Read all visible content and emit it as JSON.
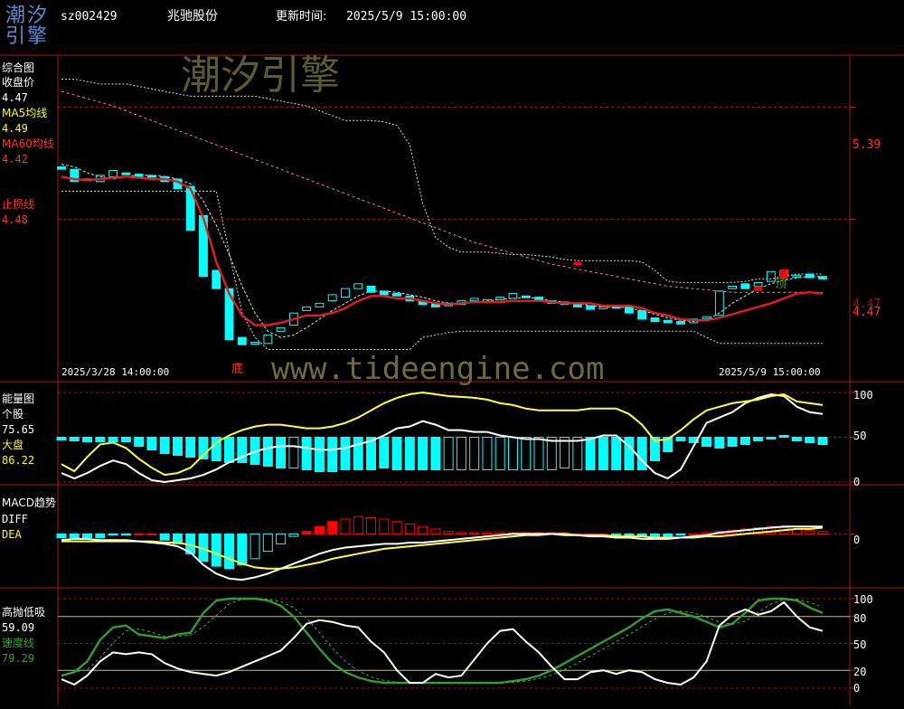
{
  "header": {
    "logo_text": "潮汐引擎",
    "symbol": "sz002429",
    "name": "兆驰股份",
    "update_label": "更新时间:",
    "update_time": "2025/5/9 15:00:00"
  },
  "watermark": {
    "title": "潮汐引擎",
    "url": "www.tideengine.com"
  },
  "colors": {
    "background": "#000000",
    "price_line": "#e61c1c",
    "price_dash": "#ff8080",
    "down_candle": "#00ffff",
    "up_candle": "#ff0000",
    "energy_line_a": "#ffff33",
    "energy_line_b": "#ffffff",
    "high_low_line": "#ffffff",
    "speed_line": "#2e9e2e"
  },
  "panels": {
    "price": {
      "title": "综合图",
      "close_label": "收盘价",
      "close_value": "4.47",
      "ma5_label": "MA5均线",
      "ma5_value": "4.49",
      "ma60_label": "MA60均线",
      "ma60_value": "4.42",
      "stop_label": "止损线",
      "stop_value": "4.48",
      "right_ticks": [
        "5.39",
        "4.47"
      ],
      "current_price": "4.47",
      "top_marker": "顶",
      "bottom_marker": "底",
      "date_start": "2025/3/28 14:00:00",
      "date_end": "2025/5/9 15:00:00"
    },
    "energy": {
      "title": "能量图",
      "stock_label": "个股",
      "stock_value": "75.65",
      "market_label": "大盘",
      "market_value": "86.22",
      "ticks": [
        "100",
        "50",
        "0"
      ]
    },
    "macd": {
      "title": "MACD趋势",
      "diff_label": "DIFF",
      "dea_label": "DEA",
      "tick": "0"
    },
    "highlow": {
      "title": "高抛低吸",
      "value": "59.09",
      "speed_label": "速度线",
      "speed_value": "79.29",
      "ticks": [
        "100",
        "80",
        "50",
        "20",
        "0"
      ]
    }
  },
  "chart_data": [
    {
      "type": "line",
      "title": "综合图",
      "n": 60,
      "ylim": [
        3.3,
        5.75
      ],
      "series": [
        {
          "name": "收盘价",
          "kind": "candles",
          "open": [
            4.9,
            4.88,
            4.8,
            4.78,
            4.82,
            4.85,
            4.84,
            4.83,
            4.82,
            4.8,
            4.74,
            4.5,
            4.05,
            3.9,
            3.5,
            3.45,
            3.45,
            3.55,
            3.6,
            3.72,
            3.75,
            3.8,
            3.83,
            3.9,
            3.92,
            3.88,
            3.86,
            3.84,
            3.8,
            3.78,
            3.76,
            3.77,
            3.8,
            3.79,
            3.81,
            3.82,
            3.84,
            3.83,
            3.8,
            3.79,
            3.78,
            3.76,
            3.74,
            3.76,
            3.75,
            3.72,
            3.66,
            3.64,
            3.63,
            3.62,
            3.66,
            3.68,
            3.9,
            3.94,
            3.92,
            3.96,
            4.05,
            4.0,
            4.02,
            4.0
          ],
          "close": [
            4.88,
            4.78,
            4.79,
            4.83,
            4.87,
            4.84,
            4.82,
            4.82,
            4.78,
            4.72,
            4.38,
            4.0,
            3.9,
            3.48,
            3.44,
            3.46,
            3.52,
            3.58,
            3.7,
            3.75,
            3.78,
            3.85,
            3.9,
            3.94,
            3.87,
            3.85,
            3.84,
            3.8,
            3.77,
            3.75,
            3.78,
            3.8,
            3.82,
            3.81,
            3.83,
            3.86,
            3.83,
            3.8,
            3.78,
            3.77,
            3.75,
            3.73,
            3.75,
            3.74,
            3.7,
            3.65,
            3.63,
            3.62,
            3.61,
            3.65,
            3.67,
            3.88,
            3.92,
            3.9,
            3.95,
            4.04,
            4.0,
            4.01,
            3.99,
            3.98
          ]
        },
        {
          "name": "MA5均线",
          "values": [
            4.92,
            4.9,
            4.85,
            4.82,
            4.8,
            4.82,
            4.83,
            4.83,
            4.82,
            4.8,
            4.76,
            4.62,
            4.42,
            4.18,
            3.92,
            3.7,
            3.55,
            3.5,
            3.52,
            3.58,
            3.65,
            3.72,
            3.78,
            3.84,
            3.88,
            3.88,
            3.87,
            3.85,
            3.83,
            3.8,
            3.78,
            3.78,
            3.79,
            3.8,
            3.81,
            3.82,
            3.83,
            3.82,
            3.8,
            3.79,
            3.78,
            3.76,
            3.75,
            3.75,
            3.74,
            3.72,
            3.69,
            3.66,
            3.64,
            3.63,
            3.64,
            3.7,
            3.78,
            3.84,
            3.9,
            3.94,
            3.97,
            3.99,
            4.0,
            4.0
          ]
        },
        {
          "name": "MA60均线",
          "values": [
            5.52,
            5.49,
            5.46,
            5.43,
            5.4,
            5.36,
            5.32,
            5.28,
            5.24,
            5.2,
            5.16,
            5.12,
            5.08,
            5.04,
            5.0,
            4.96,
            4.92,
            4.88,
            4.84,
            4.8,
            4.76,
            4.72,
            4.68,
            4.64,
            4.6,
            4.56,
            4.52,
            4.48,
            4.44,
            4.4,
            4.36,
            4.32,
            4.28,
            4.25,
            4.22,
            4.19,
            4.16,
            4.13,
            4.1,
            4.08,
            4.06,
            4.04,
            4.02,
            4.0,
            3.98,
            3.96,
            3.94,
            3.92,
            3.91,
            3.9,
            3.89,
            3.88,
            3.87,
            3.87,
            3.87,
            3.87,
            3.87,
            3.87,
            3.87,
            3.87
          ]
        },
        {
          "name": "止损线",
          "values": [
            4.82,
            4.8,
            4.79,
            4.8,
            4.81,
            4.82,
            4.81,
            4.8,
            4.8,
            4.78,
            4.72,
            4.48,
            4.12,
            3.86,
            3.68,
            3.6,
            3.6,
            3.62,
            3.65,
            3.68,
            3.68,
            3.7,
            3.74,
            3.8,
            3.84,
            3.84,
            3.82,
            3.82,
            3.8,
            3.78,
            3.77,
            3.78,
            3.79,
            3.79,
            3.79,
            3.8,
            3.8,
            3.8,
            3.79,
            3.78,
            3.78,
            3.78,
            3.76,
            3.76,
            3.76,
            3.74,
            3.7,
            3.68,
            3.65,
            3.64,
            3.64,
            3.66,
            3.69,
            3.72,
            3.75,
            3.78,
            3.82,
            3.86,
            3.87,
            3.86
          ]
        },
        {
          "name": "upper",
          "values": [
            5.62,
            5.62,
            5.6,
            5.58,
            5.58,
            5.58,
            5.56,
            5.54,
            5.52,
            5.5,
            5.48,
            5.48,
            5.48,
            5.48,
            5.48,
            5.48,
            5.46,
            5.44,
            5.42,
            5.4,
            5.36,
            5.32,
            5.28,
            5.28,
            5.28,
            5.27,
            5.24,
            5.08,
            4.6,
            4.32,
            4.24,
            4.2,
            4.2,
            4.2,
            4.19,
            4.18,
            4.18,
            4.17,
            4.16,
            4.14,
            4.13,
            4.13,
            4.13,
            4.13,
            4.13,
            4.12,
            4.05,
            3.96,
            3.95,
            3.95,
            3.95,
            3.95,
            3.95,
            3.96,
            3.98,
            3.98,
            4.0,
            4.02,
            4.02,
            4.02
          ]
        },
        {
          "name": "lower",
          "values": [
            4.7,
            4.7,
            4.7,
            4.7,
            4.7,
            4.7,
            4.7,
            4.7,
            4.7,
            4.7,
            4.7,
            4.7,
            4.7,
            4.2,
            3.7,
            3.5,
            3.4,
            3.4,
            3.4,
            3.4,
            3.4,
            3.4,
            3.4,
            3.4,
            3.4,
            3.4,
            3.4,
            3.4,
            3.5,
            3.52,
            3.54,
            3.55,
            3.55,
            3.55,
            3.55,
            3.55,
            3.55,
            3.55,
            3.55,
            3.55,
            3.55,
            3.55,
            3.55,
            3.55,
            3.55,
            3.55,
            3.55,
            3.55,
            3.55,
            3.55,
            3.5,
            3.45,
            3.45,
            3.45,
            3.45,
            3.45,
            3.45,
            3.45,
            3.45,
            3.45
          ]
        }
      ]
    },
    {
      "type": "bar",
      "title": "能量图",
      "ylim": [
        0,
        100
      ],
      "series": [
        {
          "name": "个股",
          "values": [
            20,
            12,
            28,
            42,
            44,
            38,
            26,
            16,
            8,
            10,
            16,
            30,
            44,
            52,
            58,
            62,
            64,
            64,
            62,
            60,
            60,
            62,
            66,
            72,
            80,
            88,
            94,
            98,
            100,
            98,
            96,
            95,
            94,
            92,
            88,
            86,
            82,
            80,
            80,
            80,
            80,
            82,
            82,
            82,
            76,
            64,
            46,
            48,
            58,
            70,
            80,
            84,
            88,
            90,
            92,
            96,
            98,
            90,
            88,
            86
          ]
        },
        {
          "name": "大盘",
          "values": [
            10,
            4,
            10,
            18,
            24,
            20,
            10,
            2,
            0,
            2,
            4,
            8,
            14,
            22,
            28,
            34,
            38,
            40,
            40,
            38,
            36,
            36,
            38,
            42,
            46,
            52,
            60,
            62,
            68,
            64,
            58,
            58,
            56,
            56,
            52,
            50,
            48,
            48,
            46,
            46,
            46,
            48,
            52,
            52,
            40,
            24,
            10,
            4,
            14,
            40,
            66,
            72,
            78,
            88,
            94,
            98,
            96,
            84,
            78,
            76
          ]
        },
        {
          "name": "histogram",
          "values": [
            -3,
            -4,
            -5,
            -5,
            -5,
            -5,
            -10,
            -14,
            -18,
            -20,
            -22,
            -24,
            -26,
            -28,
            -28,
            -30,
            -32,
            -34,
            -34,
            -36,
            -38,
            -38,
            -36,
            -36,
            -36,
            -34,
            -36,
            -36,
            -36,
            -36,
            -36,
            -36,
            -36,
            -36,
            -36,
            -36,
            -36,
            -36,
            -36,
            -34,
            -36,
            -36,
            -36,
            -36,
            -36,
            -36,
            -26,
            -16,
            -4,
            -6,
            -10,
            -12,
            -10,
            -8,
            -4,
            -2,
            2,
            -4,
            -6,
            -8
          ]
        }
      ]
    },
    {
      "type": "bar",
      "title": "MACD趋势",
      "ylim": [
        -0.42,
        0.28
      ],
      "series": [
        {
          "name": "DIFF",
          "values": [
            -0.05,
            -0.04,
            -0.04,
            -0.05,
            -0.05,
            -0.05,
            -0.06,
            -0.07,
            -0.08,
            -0.1,
            -0.15,
            -0.25,
            -0.32,
            -0.36,
            -0.37,
            -0.35,
            -0.32,
            -0.28,
            -0.24,
            -0.2,
            -0.16,
            -0.13,
            -0.11,
            -0.1,
            -0.09,
            -0.08,
            -0.08,
            -0.07,
            -0.07,
            -0.06,
            -0.05,
            -0.04,
            -0.03,
            -0.02,
            -0.01,
            0.0,
            0.0,
            0.0,
            0.0,
            -0.01,
            -0.01,
            -0.02,
            -0.02,
            -0.03,
            -0.03,
            -0.04,
            -0.04,
            -0.04,
            -0.03,
            -0.02,
            -0.01,
            0.01,
            0.02,
            0.03,
            0.04,
            0.05,
            0.06,
            0.06,
            0.06,
            0.06
          ]
        },
        {
          "name": "DEA",
          "values": [
            -0.06,
            -0.06,
            -0.06,
            -0.06,
            -0.06,
            -0.06,
            -0.06,
            -0.06,
            -0.07,
            -0.07,
            -0.09,
            -0.12,
            -0.16,
            -0.2,
            -0.24,
            -0.27,
            -0.28,
            -0.28,
            -0.27,
            -0.25,
            -0.23,
            -0.2,
            -0.18,
            -0.16,
            -0.14,
            -0.12,
            -0.11,
            -0.1,
            -0.09,
            -0.08,
            -0.07,
            -0.06,
            -0.05,
            -0.04,
            -0.03,
            -0.02,
            -0.01,
            -0.01,
            0.0,
            0.0,
            -0.01,
            -0.01,
            -0.01,
            -0.02,
            -0.02,
            -0.02,
            -0.03,
            -0.03,
            -0.03,
            -0.03,
            -0.02,
            -0.02,
            -0.01,
            0.0,
            0.01,
            0.02,
            0.03,
            0.04,
            0.04,
            0.05
          ]
        },
        {
          "name": "MACD",
          "values": [
            -0.03,
            -0.03,
            -0.03,
            -0.03,
            -0.01,
            -0.01,
            0.0,
            0.0,
            -0.05,
            -0.08,
            -0.16,
            -0.22,
            -0.26,
            -0.28,
            -0.25,
            -0.2,
            -0.14,
            -0.08,
            -0.02,
            0.02,
            0.06,
            0.1,
            0.12,
            0.14,
            0.13,
            0.12,
            0.1,
            0.08,
            0.06,
            0.04,
            0.02,
            0.01,
            0.01,
            0.01,
            0.01,
            0.01,
            0.01,
            0.01,
            0.01,
            0.01,
            0.0,
            0.0,
            0.0,
            -0.01,
            -0.01,
            -0.02,
            -0.02,
            -0.02,
            -0.01,
            0.0,
            0.01,
            0.02,
            0.03,
            0.04,
            0.05,
            0.06,
            0.05,
            0.04,
            0.03,
            0.02
          ]
        }
      ]
    },
    {
      "type": "line",
      "title": "高抛低吸",
      "ylim": [
        0,
        100
      ],
      "series": [
        {
          "name": "高抛低吸",
          "values": [
            10,
            4,
            14,
            30,
            40,
            38,
            40,
            38,
            28,
            22,
            18,
            16,
            14,
            18,
            24,
            30,
            36,
            42,
            56,
            72,
            76,
            74,
            70,
            68,
            52,
            40,
            20,
            6,
            6,
            16,
            12,
            14,
            32,
            50,
            64,
            66,
            52,
            40,
            24,
            10,
            10,
            18,
            20,
            16,
            20,
            18,
            10,
            6,
            4,
            12,
            30,
            70,
            82,
            88,
            82,
            86,
            96,
            80,
            68,
            64
          ]
        },
        {
          "name": "速度线",
          "values": [
            14,
            18,
            30,
            54,
            68,
            70,
            60,
            58,
            56,
            60,
            62,
            84,
            98,
            100,
            100,
            100,
            98,
            92,
            80,
            62,
            44,
            28,
            18,
            12,
            8,
            6,
            6,
            6,
            6,
            6,
            6,
            6,
            6,
            6,
            6,
            8,
            10,
            14,
            20,
            28,
            36,
            44,
            52,
            60,
            68,
            78,
            86,
            88,
            84,
            80,
            74,
            68,
            72,
            84,
            98,
            100,
            100,
            98,
            90,
            84
          ]
        }
      ]
    }
  ]
}
